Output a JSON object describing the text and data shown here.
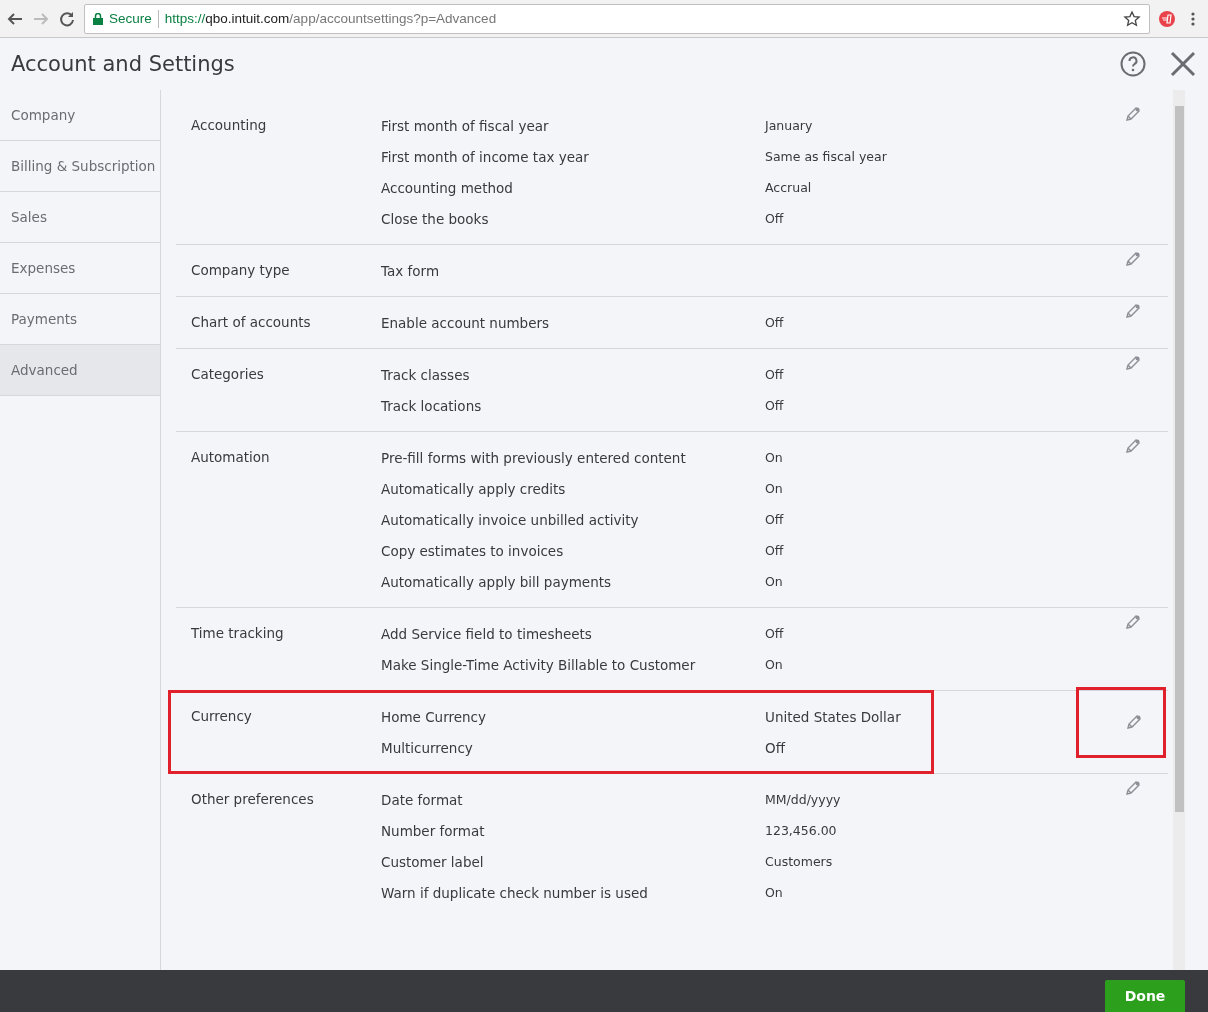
{
  "browser": {
    "secure_label": "Secure",
    "url_scheme": "https://",
    "url_host": "qbo.intuit.com",
    "url_path": "/app/accountsettings?p=Advanced"
  },
  "title": "Account and Settings",
  "sidebar": {
    "items": [
      {
        "label": "Company",
        "selected": false
      },
      {
        "label": "Billing & Subscription",
        "selected": false
      },
      {
        "label": "Sales",
        "selected": false
      },
      {
        "label": "Expenses",
        "selected": false
      },
      {
        "label": "Payments",
        "selected": false
      },
      {
        "label": "Advanced",
        "selected": true
      }
    ]
  },
  "sections": [
    {
      "label": "Accounting",
      "settings": [
        {
          "name": "First month of fiscal year",
          "value": "January"
        },
        {
          "name": "First month of income tax year",
          "value": "Same as fiscal year"
        },
        {
          "name": "Accounting method",
          "value": "Accrual"
        },
        {
          "name": "Close the books",
          "value": "Off"
        }
      ]
    },
    {
      "label": "Company type",
      "settings": [
        {
          "name": "Tax form"
        }
      ]
    },
    {
      "label": "Chart of accounts",
      "settings": [
        {
          "name": "Enable account numbers",
          "value": "Off"
        }
      ]
    },
    {
      "label": "Categories",
      "settings": [
        {
          "name": "Track classes",
          "value": "Off"
        },
        {
          "name": "Track locations",
          "value": "Off"
        }
      ]
    },
    {
      "label": "Automation",
      "settings": [
        {
          "name": "Pre-fill forms with previously entered content",
          "value": "On"
        },
        {
          "name": "Automatically apply credits",
          "value": "On"
        },
        {
          "name": "Automatically invoice unbilled activity",
          "value": "Off"
        },
        {
          "name": "Copy estimates to invoices",
          "value": "Off"
        },
        {
          "name": "Automatically apply bill payments",
          "value": "On"
        }
      ]
    },
    {
      "label": "Time tracking",
      "settings": [
        {
          "name": "Add Service field to timesheets",
          "value": "Off"
        },
        {
          "name": "Make Single-Time Activity Billable to Customer",
          "value": "On"
        }
      ]
    },
    {
      "label": "Currency",
      "highlighted": true,
      "edit_highlighted": true,
      "settings": [
        {
          "name": "Home Currency",
          "value": "United States Dollar"
        },
        {
          "name": "Multicurrency",
          "value": "Off"
        }
      ]
    },
    {
      "label": "Other preferences",
      "settings": [
        {
          "name": "Date format",
          "value": "MM/dd/yyyy"
        },
        {
          "name": "Number format",
          "value": "123,456.00"
        },
        {
          "name": "Customer label",
          "value": "Customers"
        },
        {
          "name": "Warn if duplicate check number is used",
          "value": "On"
        }
      ]
    }
  ],
  "footer": {
    "done_label": "Done"
  }
}
